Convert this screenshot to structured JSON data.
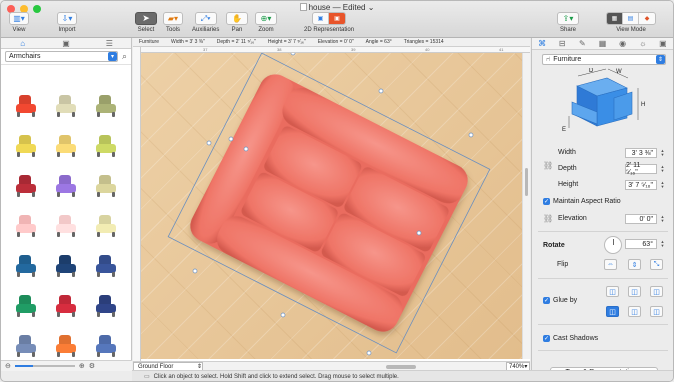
{
  "app": {
    "title": "house — Edited",
    "title_suffix": "⌄"
  },
  "toolbar": {
    "view": "View",
    "import": "Import",
    "select": "Select",
    "tools": "Tools",
    "auxiliaries": "Auxiliaries",
    "pan": "Pan",
    "zoom": "Zoom",
    "rep2d": "2D Representation",
    "share": "Share",
    "viewmode": "View Mode"
  },
  "library": {
    "category": "Armchairs",
    "items": [
      "#d8402c",
      "#c9c5a4",
      "#9aa06a",
      "#d6c24c",
      "#e0c46a",
      "#b8c35a",
      "#a82934",
      "#8b6acb",
      "#c4bf8c",
      "#f0b4b4",
      "#f2c8c8",
      "#d8d3a0",
      "#1f5e8e",
      "#1c3d6b",
      "#334c8a",
      "#1d8c5a",
      "#c02838",
      "#2b3e7a",
      "#6a7ea4",
      "#e07030",
      "#4d6aa8"
    ],
    "icons": [
      "cube-icon",
      "list-icon"
    ]
  },
  "canvas": {
    "floor": "Ground Floor",
    "zoom": "740%",
    "info": {
      "type": "Furniture",
      "width": "Width = 3' 3 ⅜\"",
      "depth": "Depth = 2' 11 ⁵⁄₁₆\"",
      "height": "Height = 3' 7 ⁵⁄₁₆\"",
      "elevation": "Elevation = 0' 0\"",
      "angle": "Angle = 63°",
      "triangles": "Triangles = 15314"
    },
    "ruler": [
      "37",
      "38",
      "39",
      "40",
      "41"
    ]
  },
  "inspector": {
    "type": "Furniture",
    "dims": {
      "d": "D",
      "w": "W",
      "h": "H",
      "e": "E"
    },
    "width_label": "Width",
    "width_value": "3' 3 ⅜\"",
    "depth_label": "Depth",
    "depth_value": "2' 11 ⁵⁄₁₆\"",
    "height_label": "Height",
    "height_value": "3' 7 ⁵⁄₁₆\"",
    "aspect_label": "Maintain Aspect Ratio",
    "elevation_label": "Elevation",
    "elevation_value": "0' 0\"",
    "rotate_label": "Rotate",
    "rotate_value": "63°",
    "flip_label": "Flip",
    "glue_label": "Glue by",
    "shadows_label": "Cast Shadows",
    "type_button": "Type & Representation..."
  },
  "status": {
    "text": "Click an object to select. Hold Shift and click to extend select. Drag mouse to select multiple."
  },
  "colors": {
    "accent": "#2f7de1",
    "sofa": "#f07a6e",
    "floor": "#e9c89a"
  }
}
